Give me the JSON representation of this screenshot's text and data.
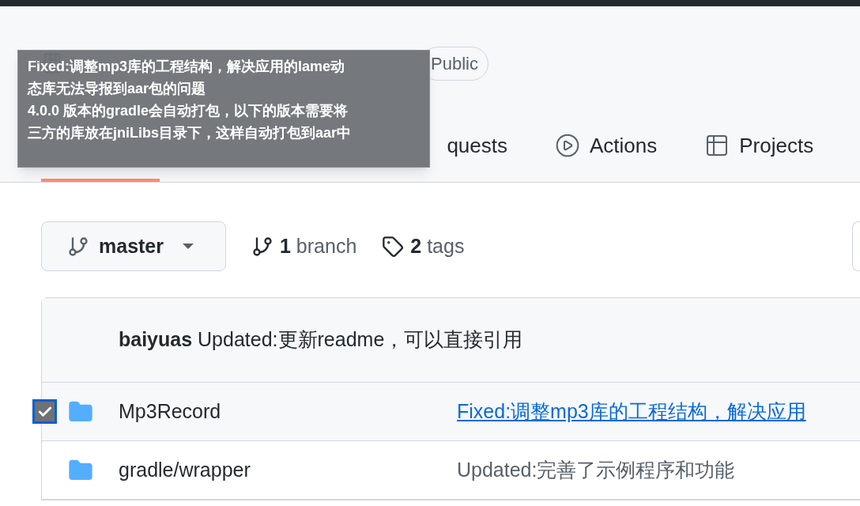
{
  "repo": {
    "visibility": "Public"
  },
  "tabs": [
    {
      "kind": "hidden",
      "selected": true
    },
    {
      "kind": "pulls",
      "label": "quests",
      "selected": false
    },
    {
      "kind": "actions",
      "label": "Actions",
      "selected": false
    },
    {
      "kind": "projects",
      "label": "Projects",
      "selected": false
    }
  ],
  "tooltip": {
    "lines": [
      "Fixed:调整mp3库的工程结构，解决应用的lame动",
      "态库无法导报到aar包的问题",
      "4.0.0 版本的gradle会自动打包，以下的版本需要将",
      "三方的库放在jniLibs目录下，这样自动打包到aar中"
    ]
  },
  "branch_select": {
    "value": "master"
  },
  "branches": {
    "count": "1",
    "label": "branch"
  },
  "tags": {
    "count": "2",
    "label": "tags"
  },
  "latest_commit": {
    "author": "baiyuas",
    "message": "Updated:更新readme，可以直接引用"
  },
  "files": [
    {
      "name": "Mp3Record",
      "checked": true,
      "message": "Fixed:调整mp3库的工程结构，解决应用",
      "link": true
    },
    {
      "name": "gradle/wrapper",
      "checked": false,
      "message": "Updated:完善了示例程序和功能",
      "link": false
    }
  ]
}
